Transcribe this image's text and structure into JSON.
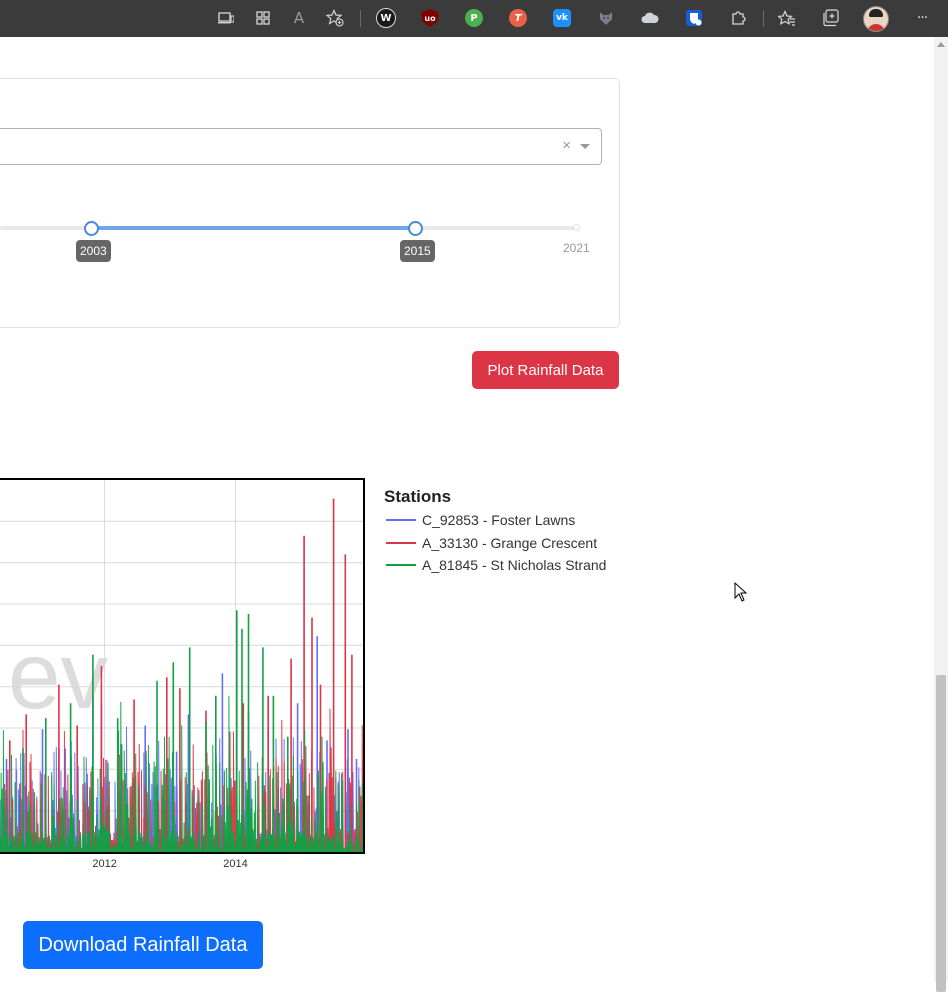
{
  "browser": {
    "toolbar_icons": [
      "app-available-icon",
      "apps-grid-icon",
      "read-aloud-icon",
      "add-favorite-icon"
    ],
    "read_aloud_glyph": "A",
    "extensions": [
      {
        "name": "wappalyzer-extension-icon",
        "glyph": "W",
        "color": "#1b1b1b"
      },
      {
        "name": "ublock-origin-extension-icon",
        "glyph": "uo",
        "color": "#800000"
      },
      {
        "name": "pushbullet-extension-icon",
        "glyph": "P",
        "color": "#4caf50"
      },
      {
        "name": "t-extension-icon",
        "glyph": "T",
        "color": "#e8624a"
      },
      {
        "name": "vk-extension-icon",
        "glyph": "vk",
        "color": "#1e90ff"
      },
      {
        "name": "wolf-extension-icon",
        "glyph": "",
        "color": "#7a7f8a"
      },
      {
        "name": "cloud-extension-icon",
        "glyph": "",
        "color": "#cfd3d8"
      },
      {
        "name": "bitwarden-extension-icon",
        "glyph": "",
        "color": "#175ddc"
      }
    ],
    "more_glyph": "···"
  },
  "filters": {
    "year_range": {
      "start_label": "2003",
      "end_label": "2015",
      "max_label": "2021"
    },
    "clear_glyph": "×"
  },
  "plot_button_label": "Plot Rainfall Data",
  "download_button_label": "Download Rainfall Data",
  "chart": {
    "watermark": "ev",
    "legend_title": "Stations",
    "stations": [
      {
        "label": "C_92853 - Foster Lawns",
        "color": "#636efa"
      },
      {
        "label": "A_33130 - Grange Crescent",
        "color": "#dc3545"
      },
      {
        "label": "A_81845 - St Nicholas Strand",
        "color": "#10a144"
      }
    ]
  },
  "chart_data": {
    "type": "line",
    "title": "",
    "xlabel": "",
    "ylabel": "",
    "x_ticks": [
      "2012",
      "2014"
    ],
    "x_tick_years": [
      2012,
      2014
    ],
    "xlim": [
      2010.4,
      2015.95
    ],
    "ylim": [
      0,
      100
    ],
    "grid": true,
    "legend_title": "Stations",
    "legend_position": "right",
    "series": [
      {
        "name": "C_92853 - Foster Lawns",
        "color": "#636efa",
        "peaks": [
          {
            "x": 2010.5,
            "y": 25
          },
          {
            "x": 2010.65,
            "y": 22
          },
          {
            "x": 2011.05,
            "y": 33
          },
          {
            "x": 2011.3,
            "y": 28
          },
          {
            "x": 2011.82,
            "y": 42
          },
          {
            "x": 2011.95,
            "y": 40
          },
          {
            "x": 2012.25,
            "y": 29
          },
          {
            "x": 2012.62,
            "y": 34
          },
          {
            "x": 2013.1,
            "y": 27
          },
          {
            "x": 2013.28,
            "y": 37
          },
          {
            "x": 2013.8,
            "y": 48
          },
          {
            "x": 2014.2,
            "y": 38
          },
          {
            "x": 2014.5,
            "y": 33
          },
          {
            "x": 2014.95,
            "y": 40
          },
          {
            "x": 2015.25,
            "y": 58
          },
          {
            "x": 2015.4,
            "y": 30
          },
          {
            "x": 2015.72,
            "y": 33
          },
          {
            "x": 2015.85,
            "y": 25
          }
        ]
      },
      {
        "name": "A_33130 - Grange Crescent",
        "color": "#dc3545",
        "peaks": [
          {
            "x": 2010.55,
            "y": 30
          },
          {
            "x": 2010.8,
            "y": 37
          },
          {
            "x": 2011.3,
            "y": 45
          },
          {
            "x": 2011.58,
            "y": 34
          },
          {
            "x": 2011.95,
            "y": 50
          },
          {
            "x": 2012.45,
            "y": 41
          },
          {
            "x": 2012.95,
            "y": 47
          },
          {
            "x": 2013.15,
            "y": 44
          },
          {
            "x": 2013.55,
            "y": 38
          },
          {
            "x": 2014.12,
            "y": 40
          },
          {
            "x": 2014.5,
            "y": 42
          },
          {
            "x": 2014.85,
            "y": 52
          },
          {
            "x": 2015.05,
            "y": 85
          },
          {
            "x": 2015.17,
            "y": 63
          },
          {
            "x": 2015.3,
            "y": 45
          },
          {
            "x": 2015.5,
            "y": 95
          },
          {
            "x": 2015.68,
            "y": 80
          },
          {
            "x": 2015.78,
            "y": 53
          }
        ]
      },
      {
        "name": "A_81845 - St Nicholas Strand",
        "color": "#10a144",
        "peaks": [
          {
            "x": 2010.75,
            "y": 28
          },
          {
            "x": 2011.1,
            "y": 36
          },
          {
            "x": 2011.48,
            "y": 40
          },
          {
            "x": 2011.82,
            "y": 53
          },
          {
            "x": 2012.2,
            "y": 36
          },
          {
            "x": 2012.8,
            "y": 46
          },
          {
            "x": 2013.05,
            "y": 51
          },
          {
            "x": 2013.3,
            "y": 55
          },
          {
            "x": 2013.55,
            "y": 35
          },
          {
            "x": 2013.7,
            "y": 42
          },
          {
            "x": 2014.02,
            "y": 65
          },
          {
            "x": 2014.1,
            "y": 60
          },
          {
            "x": 2014.2,
            "y": 64
          },
          {
            "x": 2014.42,
            "y": 55
          },
          {
            "x": 2014.58,
            "y": 42
          },
          {
            "x": 2014.8,
            "y": 31
          }
        ]
      }
    ]
  }
}
